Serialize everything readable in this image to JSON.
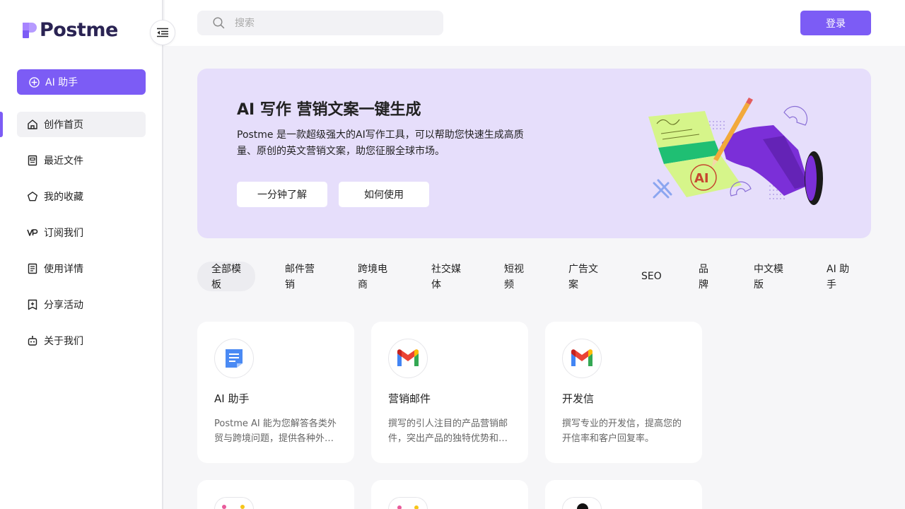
{
  "brand": {
    "name": "Postme"
  },
  "sidebar": {
    "ai_button": "AI 助手",
    "items": [
      {
        "label": "创作首页",
        "icon": "home-icon"
      },
      {
        "label": "最近文件",
        "icon": "document-icon"
      },
      {
        "label": "我的收藏",
        "icon": "pentagon-icon"
      },
      {
        "label": "订阅我们",
        "icon": "vip-icon"
      },
      {
        "label": "使用详情",
        "icon": "list-icon"
      },
      {
        "label": "分享活动",
        "icon": "share-plus-icon"
      },
      {
        "label": "关于我们",
        "icon": "robot-icon"
      }
    ]
  },
  "header": {
    "search_placeholder": "搜索",
    "login": "登录"
  },
  "banner": {
    "title": "AI 写作 营销文案一键生成",
    "description": "Postme 是一款超级强大的AI写作工具，可以帮助您快速生成高质量、原创的英文营销文案，助您征服全球市场。",
    "button1": "一分钟了解",
    "button2": "如何使用",
    "art_label": "AI"
  },
  "tabs": [
    {
      "line1": "全部模",
      "line2": "板"
    },
    {
      "line1": "邮件营",
      "line2": "销"
    },
    {
      "line1": "跨境电",
      "line2": "商"
    },
    {
      "line1": "社交媒",
      "line2": "体"
    },
    {
      "line1": "短视",
      "line2": "频"
    },
    {
      "line1": "广告文",
      "line2": "案"
    },
    {
      "line1": "SEO",
      "line2": ""
    },
    {
      "line1": "品",
      "line2": "牌"
    },
    {
      "line1": "中文模",
      "line2": "版"
    },
    {
      "line1": "AI 助",
      "line2": "手"
    }
  ],
  "cards": [
    {
      "title": "AI 助手",
      "desc": "Postme AI 能为您解答各类外贸与跨境问题，提供各种外贸与跨境业务相关的帮助。",
      "icon": "doc-blue-icon"
    },
    {
      "title": "营销邮件",
      "desc": "撰写的引人注目的产品营销邮件，突出产品的独特优势和卖点。",
      "icon": "gmail-icon"
    },
    {
      "title": "开发信",
      "desc": "撰写专业的开发信，提高您的开信率和客户回复率。",
      "icon": "gmail-icon"
    }
  ],
  "colors": {
    "accent": "#7c5cf5",
    "banner_bg": "#e6defb"
  }
}
